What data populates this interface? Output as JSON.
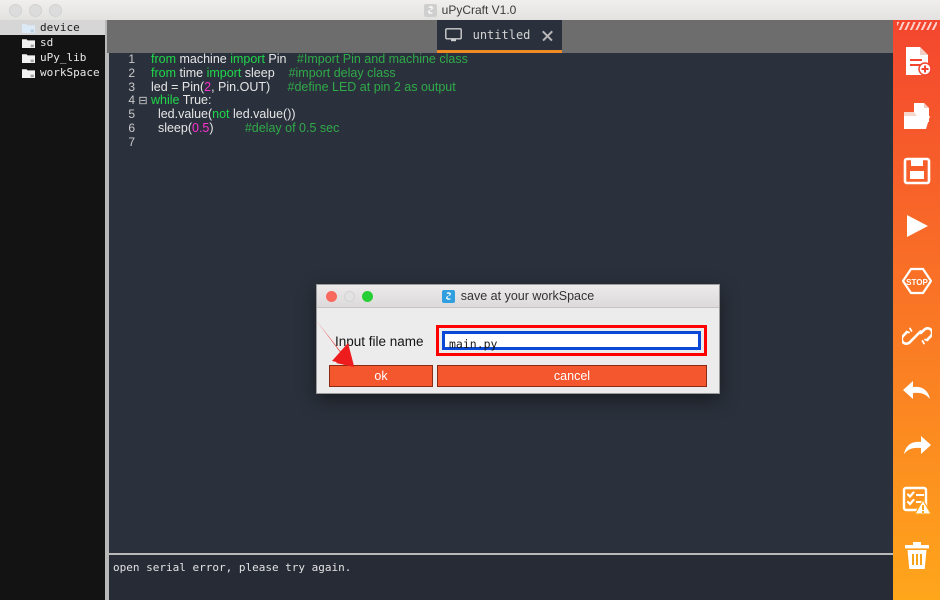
{
  "window": {
    "title": "uPyCraft V1.0",
    "logo_icon": "upycraft-logo-icon",
    "traffic_lights": [
      "close",
      "minimize",
      "zoom"
    ]
  },
  "sidebar": {
    "items": [
      {
        "label": "device",
        "icon": "folder-icon",
        "selected": true
      },
      {
        "label": "sd",
        "icon": "folder-icon",
        "selected": false
      },
      {
        "label": "uPy_lib",
        "icon": "folder-icon",
        "selected": false
      },
      {
        "label": "workSpace",
        "icon": "folder-icon",
        "selected": false
      }
    ]
  },
  "tabs": [
    {
      "label": "untitled",
      "icon": "monitor-icon",
      "close_icon": "close-icon",
      "active": true
    }
  ],
  "editor": {
    "lines": [
      {
        "num": "1",
        "fold": "",
        "tokens": [
          {
            "t": "from ",
            "c": "kw"
          },
          {
            "t": "machine ",
            "c": "id"
          },
          {
            "t": "import ",
            "c": "kw"
          },
          {
            "t": "Pin",
            "c": "id"
          },
          {
            "t": "   ",
            "c": "id"
          },
          {
            "t": "#Import Pin and machine class",
            "c": "cm"
          }
        ]
      },
      {
        "num": "2",
        "fold": "",
        "tokens": [
          {
            "t": "from ",
            "c": "kw"
          },
          {
            "t": "time ",
            "c": "id"
          },
          {
            "t": "import ",
            "c": "kw"
          },
          {
            "t": "sleep",
            "c": "id"
          },
          {
            "t": "    ",
            "c": "id"
          },
          {
            "t": "#import delay class",
            "c": "cm"
          }
        ]
      },
      {
        "num": "3",
        "fold": "",
        "tokens": [
          {
            "t": "led = Pin(",
            "c": "id"
          },
          {
            "t": "2",
            "c": "num"
          },
          {
            "t": ", Pin.OUT)",
            "c": "id"
          },
          {
            "t": "     ",
            "c": "id"
          },
          {
            "t": "#define LED at pin 2 as output",
            "c": "cm"
          }
        ]
      },
      {
        "num": "4",
        "fold": "⊟",
        "tokens": [
          {
            "t": "while ",
            "c": "kw"
          },
          {
            "t": "True:",
            "c": "id"
          }
        ]
      },
      {
        "num": "5",
        "fold": "",
        "tokens": [
          {
            "t": "  led.value(",
            "c": "id"
          },
          {
            "t": "not ",
            "c": "kw"
          },
          {
            "t": "led.value())",
            "c": "id"
          }
        ]
      },
      {
        "num": "6",
        "fold": "",
        "tokens": [
          {
            "t": "  sleep(",
            "c": "id"
          },
          {
            "t": "0.5",
            "c": "num"
          },
          {
            "t": ")",
            "c": "id"
          },
          {
            "t": "         ",
            "c": "id"
          },
          {
            "t": "#delay of 0.5 sec",
            "c": "cm"
          }
        ]
      },
      {
        "num": "7",
        "fold": "",
        "tokens": []
      }
    ]
  },
  "terminal": {
    "message": "open serial error, please try again."
  },
  "toolbar": {
    "buttons": [
      {
        "name": "new-file-icon",
        "title": "New file"
      },
      {
        "name": "open-file-icon",
        "title": "Open file"
      },
      {
        "name": "save-file-icon",
        "title": "Save file"
      },
      {
        "name": "run-icon",
        "title": "Run"
      },
      {
        "name": "stop-icon",
        "title": "Stop"
      },
      {
        "name": "disconnect-icon",
        "title": "Disconnect"
      },
      {
        "name": "undo-icon",
        "title": "Undo"
      },
      {
        "name": "redo-icon",
        "title": "Redo"
      },
      {
        "name": "syntax-check-icon",
        "title": "Syntax check"
      },
      {
        "name": "delete-icon",
        "title": "Delete"
      }
    ]
  },
  "dialog": {
    "title": "save at your workSpace",
    "logo_icon": "upycraft-logo-icon",
    "label": "Input file name",
    "filename_value": "main.py",
    "filename_placeholder": "",
    "ok_label": "ok",
    "cancel_label": "cancel",
    "annotation_icon": "red-arrow-icon",
    "highlight_color": "#ff0000",
    "focus_color": "#0a49d8"
  },
  "colors": {
    "accent_orange": "#f08a24",
    "toolbar_top": "#f4462f",
    "toolbar_bottom": "#ffa61b",
    "button_orange": "#f4562e",
    "editor_bg": "#2b313c",
    "keyword_green": "#1fd84a",
    "comment_green": "#2faa49",
    "number_magenta": "#ff2fd0"
  }
}
